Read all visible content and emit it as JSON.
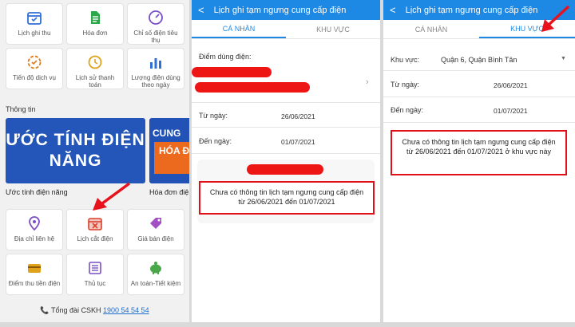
{
  "panel1": {
    "tiles_top": [
      {
        "label": "Lịch ghi thu",
        "icon": "calendar-icon"
      },
      {
        "label": "Hóa đơn",
        "icon": "invoice-icon"
      },
      {
        "label": "Chỉ số điện tiêu thụ",
        "icon": "gauge-icon"
      },
      {
        "label": "Tiến độ dịch vụ",
        "icon": "progress-icon"
      },
      {
        "label": "Lịch sử thanh toán",
        "icon": "history-icon"
      },
      {
        "label": "Lượng điện dùng theo ngày",
        "icon": "bar-chart-icon"
      }
    ],
    "section_info": "Thông tin",
    "banner_estimate": "ƯỚC TÍNH ĐIỆN NĂNG",
    "banner_invoice_top": "CUNG",
    "banner_invoice_bottom": "HÓA ĐIỆ",
    "caption_estimate": "Ước tính điện năng",
    "caption_invoice": "Hóa đơn điệ",
    "tiles_bottom": [
      {
        "label": "Địa chỉ liên hệ",
        "icon": "location-pin-icon"
      },
      {
        "label": "Lịch cắt điện",
        "icon": "calendar-x-icon"
      },
      {
        "label": "Giá bán điện",
        "icon": "price-tag-icon"
      },
      {
        "label": "Điểm thu tiền điện",
        "icon": "card-icon"
      },
      {
        "label": "Thủ tục",
        "icon": "document-list-icon"
      },
      {
        "label": "An toàn-Tiết kiệm",
        "icon": "piggy-bank-icon"
      }
    ],
    "hotline_label": "Tổng đài CSKH",
    "hotline_number": "1900 54 54 54"
  },
  "panel2": {
    "header_title": "Lịch ghi tạm ngưng cung cấp điện",
    "tab_personal": "CÁ NHÂN",
    "tab_area": "KHU VỰC",
    "usage_point_label": "Điểm dùng điện:",
    "from_label": "Từ ngày:",
    "from_value": "26/06/2021",
    "to_label": "Đến ngày:",
    "to_value": "01/07/2021",
    "message": "Chưa có thông tin lịch tạm ngưng cung cấp điện từ 26/06/2021 đến 01/07/2021"
  },
  "panel3": {
    "header_title": "Lịch ghi tạm ngưng cung cấp điện",
    "tab_personal": "CÁ NHÂN",
    "tab_area": "KHU VỰC",
    "area_label": "Khu vực:",
    "area_value": "Quận 6, Quận Bình Tân",
    "from_label": "Từ ngày:",
    "from_value": "26/06/2021",
    "to_label": "Đến ngày:",
    "to_value": "01/07/2021",
    "message": "Chưa có thông tin lịch tạm ngưng cung cấp điện từ 26/06/2021 đến 01/07/2021 ở khu vực này"
  },
  "colors": {
    "accent": "#1e88e5",
    "highlight": "#e10f1a",
    "banner": "#2455b8"
  }
}
